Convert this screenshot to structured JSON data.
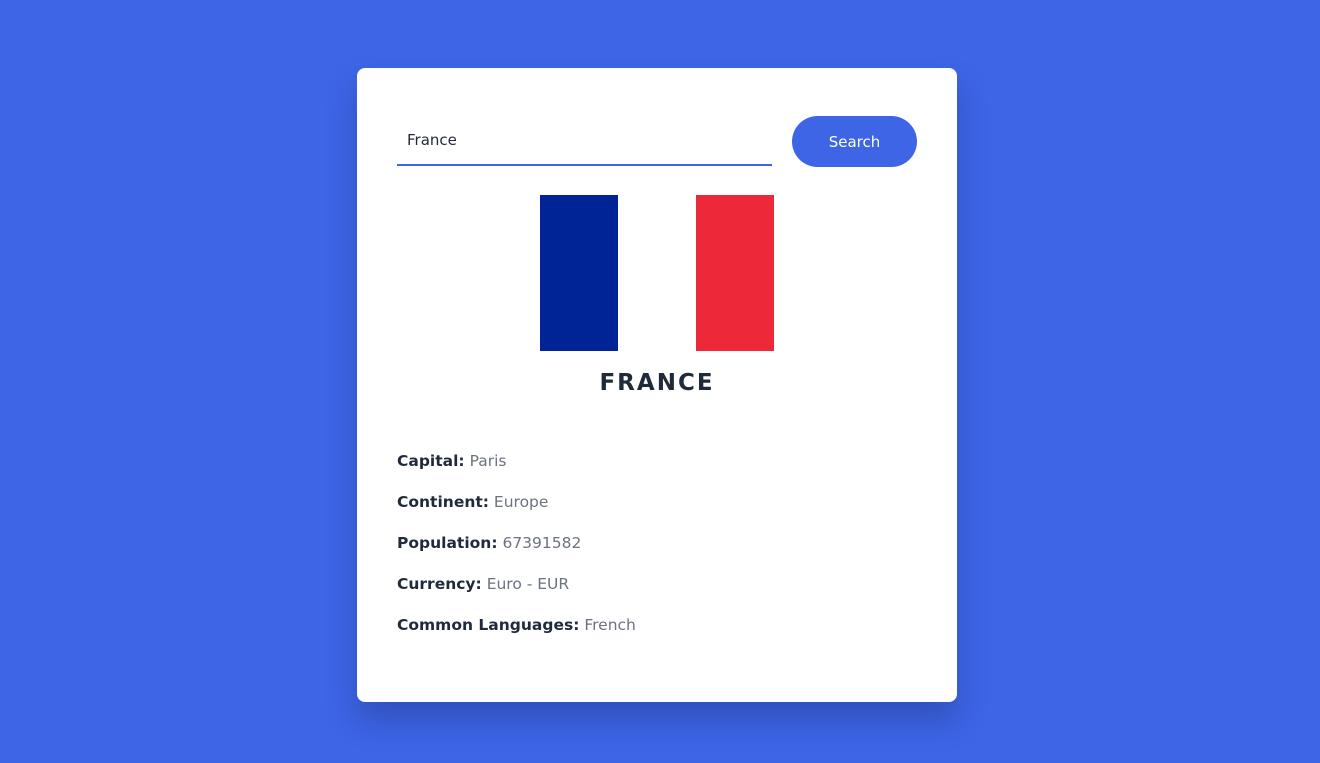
{
  "search": {
    "value": "France",
    "button_label": "Search"
  },
  "flag": {
    "colors": [
      "#002395",
      "#ffffff",
      "#ed2939"
    ]
  },
  "country": {
    "name": "FRANCE"
  },
  "details": [
    {
      "label": "Capital:",
      "value": "Paris"
    },
    {
      "label": "Continent:",
      "value": "Europe"
    },
    {
      "label": "Population:",
      "value": "67391582"
    },
    {
      "label": "Currency:",
      "value": "Euro - EUR"
    },
    {
      "label": "Common Languages:",
      "value": "French"
    }
  ],
  "colors": {
    "background": "#3d65e6",
    "accent": "#3d65e6",
    "card": "#ffffff"
  }
}
